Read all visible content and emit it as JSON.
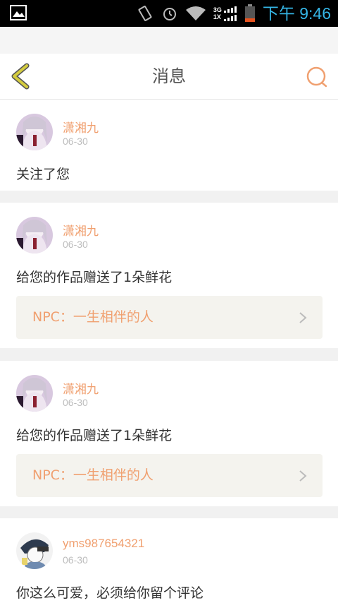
{
  "statusbar": {
    "time": "下午 9:46",
    "net_top": "3G",
    "net_bottom": "1X"
  },
  "header": {
    "title": "消息"
  },
  "messages": [
    {
      "user": "潇湘九",
      "date": "06-30",
      "text": "关注了您"
    },
    {
      "user": "潇湘九",
      "date": "06-30",
      "text": "给您的作品赠送了1朵鲜花",
      "link": "NPC：一生相伴的人"
    },
    {
      "user": "潇湘九",
      "date": "06-30",
      "text": "给您的作品赠送了1朵鲜花",
      "link": "NPC：一生相伴的人"
    },
    {
      "user": "yms987654321",
      "date": "06-30",
      "text": "你这么可爱，必须给你留个评论"
    }
  ],
  "colors": {
    "accent": "#f0a070",
    "back_arrow": "#c9c23a",
    "status_time": "#35b5e5",
    "battery": "#e8531f"
  }
}
